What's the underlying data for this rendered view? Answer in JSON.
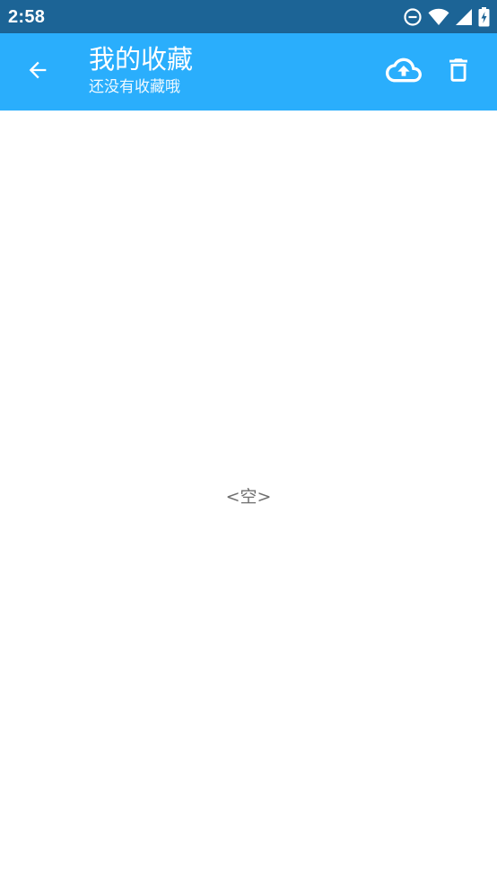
{
  "status_bar": {
    "time": "2:58",
    "icons": [
      "do-not-disturb-icon",
      "wifi-icon",
      "cellular-signal-icon",
      "battery-charging-icon"
    ]
  },
  "app_bar": {
    "title": "我的收藏",
    "subtitle": "还没有收藏哦",
    "background_color": "#2aaefc",
    "icons": {
      "back": "arrow-left-icon",
      "upload": "cloud-upload-icon",
      "delete": "trash-icon"
    }
  },
  "content": {
    "empty_text": "<空>"
  },
  "colors": {
    "status_bar": "#1c6496",
    "app_bar": "#2aaefc",
    "empty_text": "#6f6f6f"
  }
}
